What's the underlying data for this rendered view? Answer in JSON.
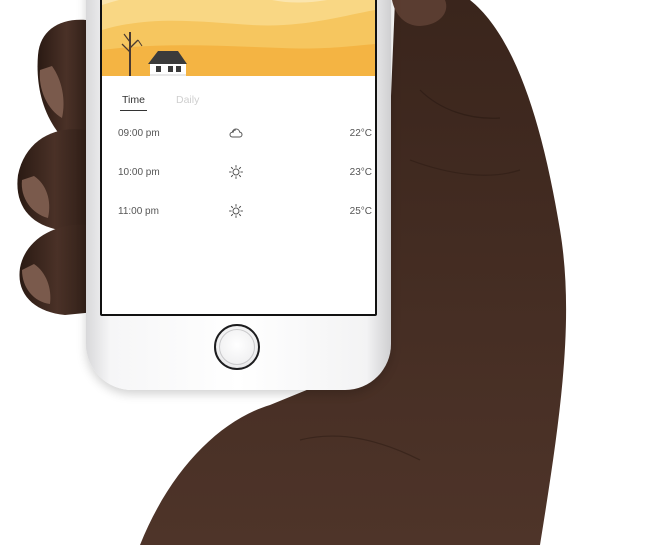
{
  "tabs": [
    {
      "label": "Time",
      "active": true
    },
    {
      "label": "Daily",
      "active": false
    }
  ],
  "forecast": [
    {
      "time": "09:00 pm",
      "icon": "cloud-icon",
      "temp": "22°C"
    },
    {
      "time": "10:00 pm",
      "icon": "sun-icon",
      "temp": "23°C"
    },
    {
      "time": "11:00 pm",
      "icon": "sun-icon",
      "temp": "25°C"
    }
  ],
  "colors": {
    "sky_light": "#fbe3a6",
    "sky_mid": "#f6c65f",
    "hill": "#f4b443",
    "house_roof": "#3b3b3b",
    "text": "#555555",
    "tab_inactive": "#cfcfcf"
  }
}
